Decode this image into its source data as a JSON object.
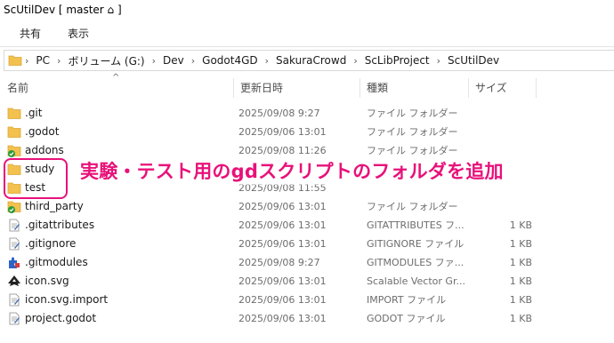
{
  "window": {
    "title": "ScUtilDev [ master ⌂ ]"
  },
  "ribbon": {
    "tabs": [
      "共有",
      "表示"
    ]
  },
  "address": {
    "segments": [
      "PC",
      "ボリューム (G:)",
      "Dev",
      "Godot4GD",
      "SakuraCrowd",
      "ScLibProject",
      "ScUtilDev"
    ]
  },
  "columns": {
    "name": "名前",
    "date": "更新日時",
    "type": "種類",
    "size": "サイズ",
    "sort_indicator": "^"
  },
  "files": [
    {
      "name": ".git",
      "date": "2025/09/08 9:27",
      "type": "ファイル フォルダー",
      "size": "",
      "icon": "folder-icon"
    },
    {
      "name": ".godot",
      "date": "2025/09/06 13:01",
      "type": "ファイル フォルダー",
      "size": "",
      "icon": "folder-icon"
    },
    {
      "name": "addons",
      "date": "2025/09/08 11:26",
      "type": "ファイル フォルダー",
      "size": "",
      "icon": "folder-synced-icon"
    },
    {
      "name": "study",
      "date": "",
      "type": "",
      "size": "",
      "icon": "folder-icon"
    },
    {
      "name": "test",
      "date": "2025/09/08 11:55",
      "type": "",
      "size": "",
      "icon": "folder-icon"
    },
    {
      "name": "third_party",
      "date": "2025/09/06 13:01",
      "type": "ファイル フォルダー",
      "size": "",
      "icon": "folder-synced-icon"
    },
    {
      "name": ".gitattributes",
      "date": "2025/09/06 13:01",
      "type": "GITATTRIBUTES フ...",
      "size": "1 KB",
      "icon": "text-file-icon"
    },
    {
      "name": ".gitignore",
      "date": "2025/09/06 13:01",
      "type": "GITIGNORE ファイル",
      "size": "1 KB",
      "icon": "text-file-icon"
    },
    {
      "name": ".gitmodules",
      "date": "2025/09/08 9:27",
      "type": "GITMODULES ファ...",
      "size": "1 KB",
      "icon": "puzzle-file-icon"
    },
    {
      "name": "icon.svg",
      "date": "2025/09/06 13:01",
      "type": "Scalable Vector Gr...",
      "size": "1 KB",
      "icon": "inkscape-icon"
    },
    {
      "name": "icon.svg.import",
      "date": "2025/09/06 13:01",
      "type": "IMPORT ファイル",
      "size": "1 KB",
      "icon": "text-file-icon"
    },
    {
      "name": "project.godot",
      "date": "2025/09/06 13:01",
      "type": "GODOT ファイル",
      "size": "1 KB",
      "icon": "text-file-icon"
    }
  ],
  "annotation": {
    "text": "実験・テスト用のgdスクリプトのフォルダを追加",
    "color": "#e8117a"
  },
  "colors": {
    "folder": "#f2c14e",
    "folder_dark": "#dca73a",
    "accent": "#e8117a",
    "sync_green": "#2e9b3b"
  }
}
